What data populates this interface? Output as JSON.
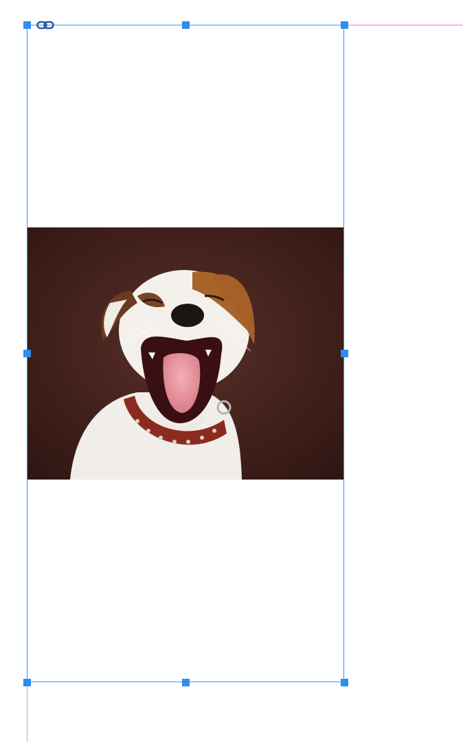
{
  "canvas": {
    "background": "#ffffff",
    "selection_color": "#2f8cf0",
    "guide_color": "#e07be6"
  },
  "selection": {
    "link_icon": "chain-link-icon",
    "handles": [
      "top-left",
      "top-center",
      "top-right",
      "middle-left",
      "middle-right",
      "bottom-left",
      "bottom-center",
      "bottom-right"
    ]
  },
  "image": {
    "subject": "dog-photo",
    "background_color": "#3e1f1b"
  }
}
